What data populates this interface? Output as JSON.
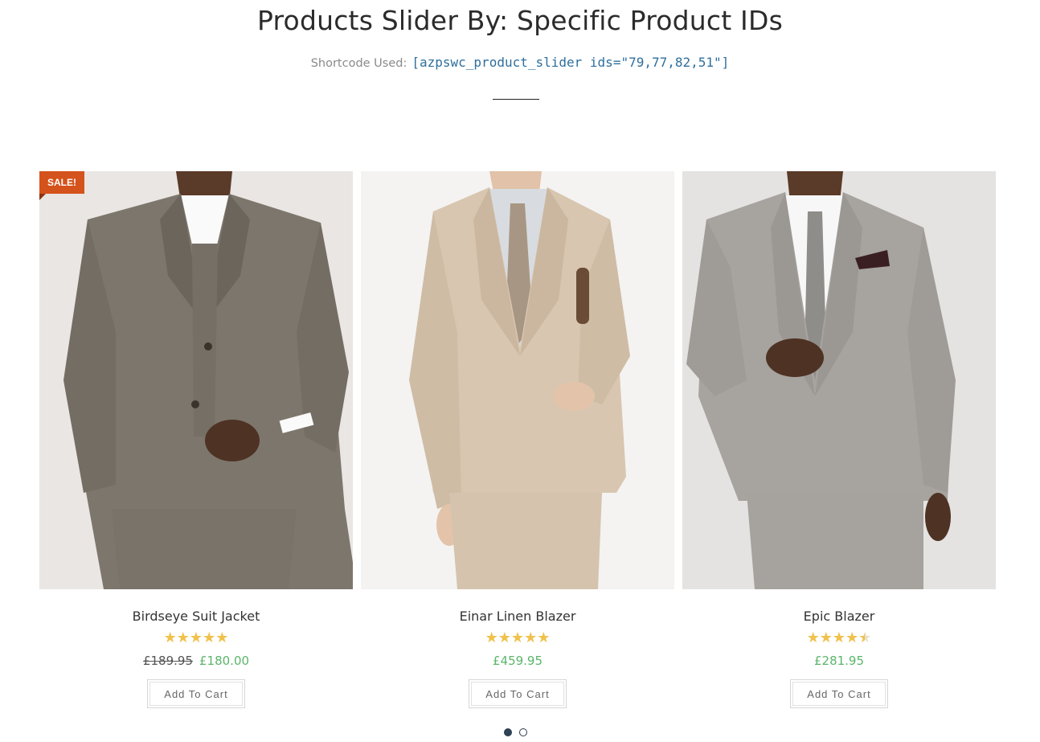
{
  "header": {
    "title": "Products Slider By: Specific Product IDs",
    "shortcode_label": "Shortcode Used:",
    "shortcode_code": "[azpswc_product_slider ids=\"79,77,82,51\"]"
  },
  "products": [
    {
      "name": "Birdseye Suit Jacket",
      "badge": "SALE!",
      "rating": 5,
      "price_old": "£189.95",
      "price": "£180.00",
      "button_label": "Add To Cart"
    },
    {
      "name": "Einar Linen Blazer",
      "rating": 5,
      "price": "£459.95",
      "button_label": "Add To Cart"
    },
    {
      "name": "Epic Blazer",
      "rating": 4.5,
      "price": "£281.95",
      "button_label": "Add To Cart"
    }
  ],
  "slider": {
    "pages": 2,
    "active_page": 1
  },
  "colors": {
    "sale_badge": "#d4521b",
    "price": "#5bb56a",
    "star": "#f0c24b",
    "shortcode": "#2e6f9e"
  }
}
